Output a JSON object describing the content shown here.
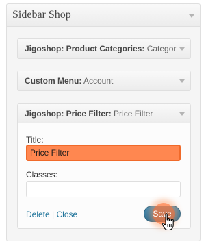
{
  "sidebar": {
    "title": "Sidebar Shop",
    "toggle_icon": "chevron-down-icon"
  },
  "widgets": [
    {
      "name_strong": "Jigoshop: Product Categories:",
      "suffix": "Categor",
      "expanded": false
    },
    {
      "name_strong": "Custom Menu:",
      "suffix": "Account",
      "expanded": false
    },
    {
      "name_strong": "Jigoshop: Price Filter:",
      "suffix": "Price Filter",
      "expanded": true,
      "form": {
        "title_label": "Title:",
        "title_value": "Price Filter",
        "classes_label": "Classes:",
        "classes_value": "",
        "delete_label": "Delete",
        "separator": "|",
        "close_label": "Close",
        "save_label": "Save"
      }
    }
  ],
  "colors": {
    "title_highlight": "#ff8750",
    "save_button": "#2e6e92",
    "link": "#21759b"
  },
  "cursor_icon": "hand-pointer-icon"
}
